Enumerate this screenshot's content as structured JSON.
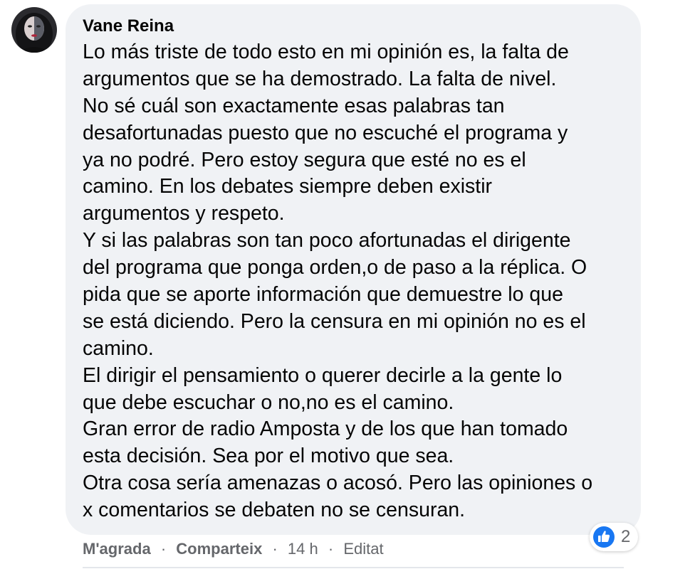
{
  "comment": {
    "author": "Vane Reina",
    "text_lines": [
      "Lo más triste de todo esto en mi opinión es, la falta de",
      "argumentos que se ha demostrado. La falta de nivel.",
      "No sé cuál son exactamente esas palabras tan",
      "desafortunadas puesto que no escuché el programa y",
      "ya no podré. Pero estoy segura que esté no es el",
      "camino. En los debates siempre deben existir",
      "argumentos y respeto.",
      "Y si las palabras son tan poco afortunadas el dirigente",
      "del programa que ponga orden,o de paso a la réplica. O",
      "pida que se aporte información que demuestre lo que",
      "se está diciendo. Pero la censura en mi opinión no es el",
      "camino.",
      "El dirigir el pensamiento o querer decirle a la gente lo",
      "que debe escuchar o no,no es el camino.",
      "Gran error de radio Amposta y de los que han tomado",
      "esta decisión. Sea por el motivo que sea.",
      "Otra cosa sería amenazas o acosó. Pero las opiniones o",
      "x comentarios se debaten no se censuran."
    ],
    "reaction_count": "2",
    "reaction_icon": "like-icon",
    "like_color": "#1877f2"
  },
  "actions": {
    "like_label": "M'agrada",
    "share_label": "Comparteix",
    "separator": "·",
    "time": "14 h",
    "edited_label": "Editat"
  }
}
